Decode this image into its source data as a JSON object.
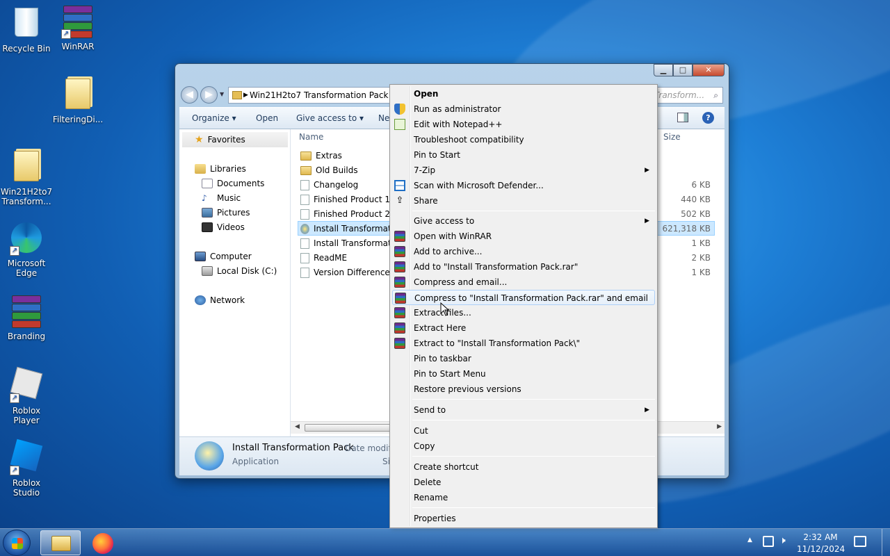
{
  "desktop": {
    "icons": [
      {
        "label": "Recycle Bin"
      },
      {
        "label": "WinRAR"
      },
      {
        "label": "FilteringDi..."
      },
      {
        "label": "Win21H2to7 Transform..."
      },
      {
        "label": "Microsoft Edge"
      },
      {
        "label": "Branding"
      },
      {
        "label": "Roblox Player"
      },
      {
        "label": "Roblox Studio"
      }
    ]
  },
  "explorer": {
    "address": "Win21H2to7 Transformation Pack",
    "search_placeholder": "Transform...",
    "toolbar": {
      "organize": "Organize ▾",
      "open": "Open",
      "give_access": "Give access to ▾",
      "new": "Ne"
    },
    "nav": {
      "favorites": "Favorites",
      "libraries": "Libraries",
      "documents": "Documents",
      "music": "Music",
      "pictures": "Pictures",
      "videos": "Videos",
      "computer": "Computer",
      "local_disk": "Local Disk (C:)",
      "network": "Network"
    },
    "columns": {
      "name": "Name",
      "size": "Size"
    },
    "files": [
      {
        "name": "Extras",
        "size": ""
      },
      {
        "name": "Old Builds",
        "size": ""
      },
      {
        "name": "Changelog",
        "size": "6 KB"
      },
      {
        "name": "Finished Product 1",
        "size": "440 KB"
      },
      {
        "name": "Finished Product 2",
        "size": "502 KB"
      },
      {
        "name": "Install Transformation Pack",
        "size": "621,318 KB"
      },
      {
        "name": "Install Transformation Pack",
        "size": "1 KB"
      },
      {
        "name": "ReadME",
        "size": "2 KB"
      },
      {
        "name": "Version Differences",
        "size": "1 KB"
      }
    ],
    "details": {
      "name": "Install Transformation Pack",
      "type": "Application",
      "date_label": "Date modifi",
      "size_label": "Si"
    }
  },
  "context_menu": {
    "open": "Open",
    "run_admin": "Run as administrator",
    "edit_notepad": "Edit with Notepad++",
    "troubleshoot": "Troubleshoot compatibility",
    "pin_start": "Pin to Start",
    "seven_zip": "7-Zip",
    "scan": "Scan with Microsoft Defender...",
    "share": "Share",
    "give_access": "Give access to",
    "open_winrar": "Open with WinRAR",
    "add_archive": "Add to archive...",
    "add_to_rar": "Add to \"Install Transformation Pack.rar\"",
    "compress_email": "Compress and email...",
    "compress_rar_email": "Compress to \"Install Transformation Pack.rar\" and email",
    "extract_files": "Extract files...",
    "extract_here": "Extract Here",
    "extract_to": "Extract to \"Install Transformation Pack\\\"",
    "pin_taskbar": "Pin to taskbar",
    "pin_start_menu": "Pin to Start Menu",
    "restore": "Restore previous versions",
    "send_to": "Send to",
    "cut": "Cut",
    "copy": "Copy",
    "create_shortcut": "Create shortcut",
    "delete": "Delete",
    "rename": "Rename",
    "properties": "Properties"
  },
  "taskbar": {
    "time": "2:32 AM",
    "date": "11/12/2024"
  },
  "colors": {
    "desktop": "#1e7fd6",
    "selection": "#cce8ff",
    "menu_highlight": "#aecff7"
  }
}
